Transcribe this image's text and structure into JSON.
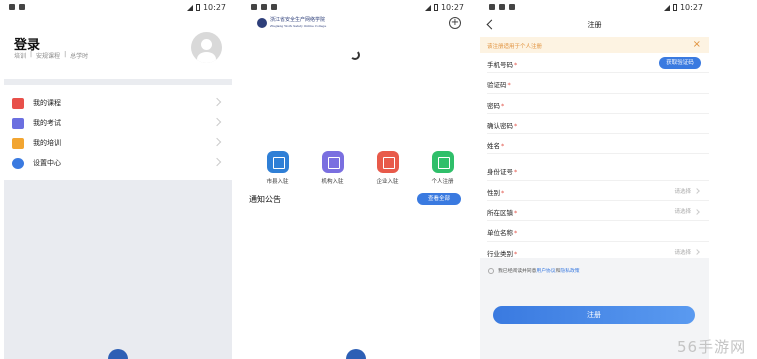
{
  "statusbar": {
    "time": "10:27"
  },
  "login_screen": {
    "title": "登录",
    "subtitle": [
      "培训",
      "|",
      "安规课程",
      "|",
      "总学时"
    ],
    "menu": [
      {
        "label": "我的课程",
        "icon": "book-icon",
        "color": "#e8504a"
      },
      {
        "label": "我的考试",
        "icon": "pen-icon",
        "color": "#6b6fe0"
      },
      {
        "label": "我的培训",
        "icon": "folder-icon",
        "color": "#f2a531"
      },
      {
        "label": "设置中心",
        "icon": "gear-icon",
        "color": "#3a7ae0"
      }
    ]
  },
  "home_screen": {
    "logo_text_line1": "浙江省安全生产网络学院",
    "logo_text_line2": "Zhejiang Work Safety Online College",
    "entries": [
      {
        "label": "市县入驻",
        "icon": "building-icon",
        "color": "#2f7fd6"
      },
      {
        "label": "机构入驻",
        "icon": "document-icon",
        "color": "#7a6fe0"
      },
      {
        "label": "企业入驻",
        "icon": "company-icon",
        "color": "#e85a4a"
      },
      {
        "label": "个人注册",
        "icon": "user-icon",
        "color": "#2fbf6a"
      }
    ],
    "notice_title": "通知公告",
    "view_all": "查看全部"
  },
  "register_screen": {
    "title": "注册",
    "tip": "该注册适用于个人注册",
    "get_code": "获取验证码",
    "select_placeholder": "请选择",
    "fields": [
      {
        "label": "手机号码",
        "required": "*",
        "type": "input"
      },
      {
        "label": "验证码",
        "required": "*",
        "type": "input"
      },
      {
        "label": "密码",
        "required": "*",
        "type": "input"
      },
      {
        "label": "确认密码",
        "required": "*",
        "type": "input"
      },
      {
        "label": "姓名",
        "required": "*",
        "type": "input"
      }
    ],
    "fields2": [
      {
        "label": "身份证号",
        "required": "*",
        "type": "input"
      },
      {
        "label": "性别",
        "required": "*",
        "type": "select"
      },
      {
        "label": "所在区镇",
        "required": "*",
        "type": "select"
      },
      {
        "label": "单位名称",
        "required": "*",
        "type": "input"
      },
      {
        "label": "行业类别",
        "required": "*",
        "type": "select"
      }
    ],
    "agree_prefix": "我已经阅读并同意",
    "agree_link1": "用户协议",
    "agree_and": "和",
    "agree_link2": "隐私政策",
    "submit": "注册"
  },
  "watermark": "56手游网"
}
